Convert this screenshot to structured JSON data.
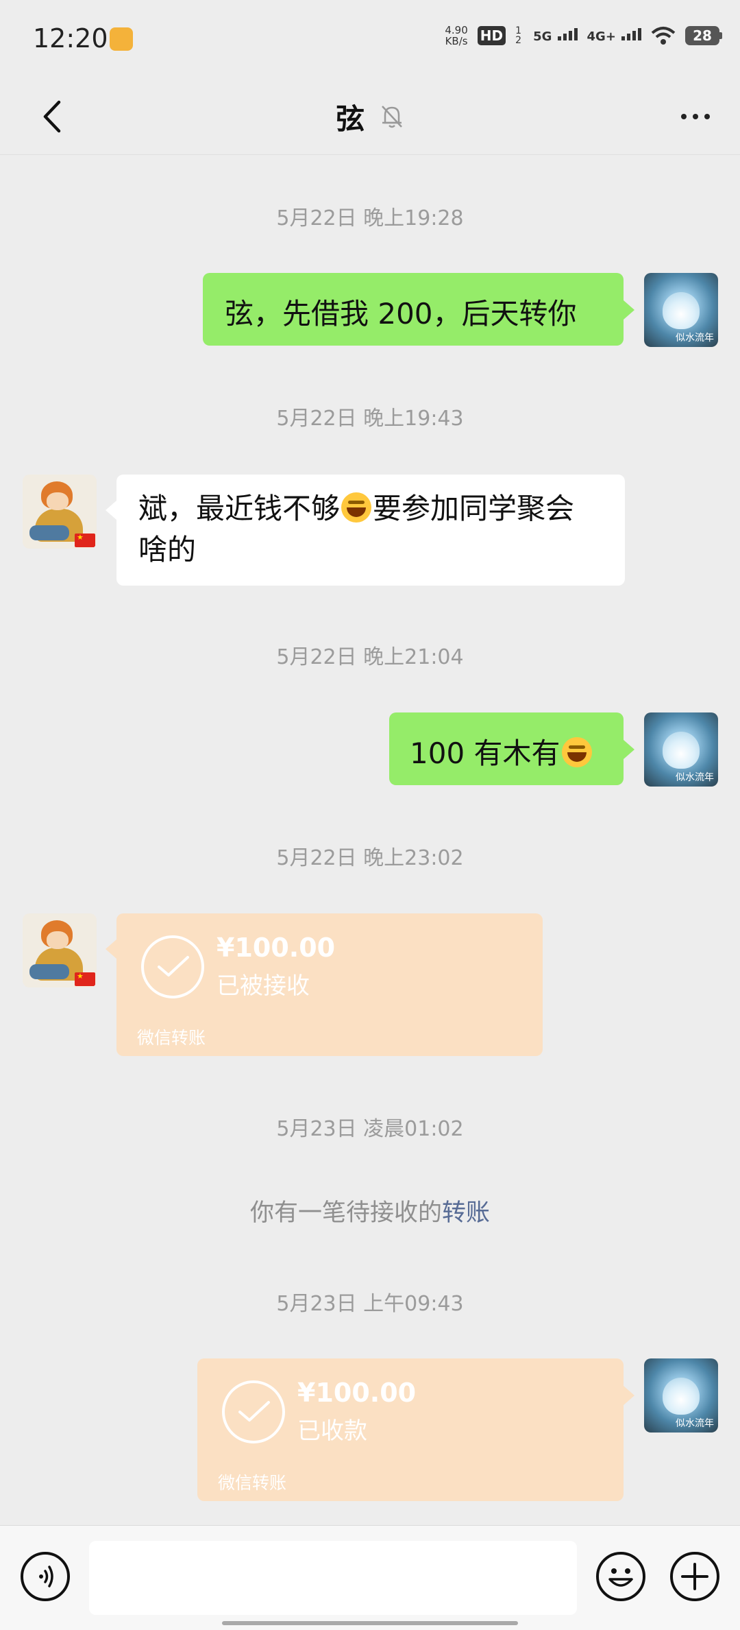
{
  "status_bar": {
    "time": "12:20",
    "net_speed_value": "4.90",
    "net_speed_unit": "KB/s",
    "hd_label": "HD",
    "hd_sub": "1 2",
    "sig1": "5G",
    "sig2": "4G+",
    "battery": "28"
  },
  "header": {
    "title": "弦",
    "mute_icon": "bell-off-icon",
    "back_icon": "chevron-left-icon",
    "more_icon": "more-dots-icon"
  },
  "messages": [
    {
      "type": "timestamp",
      "text": "5月22日 晚上19:28"
    },
    {
      "type": "text",
      "side": "right",
      "text": "弦，先借我 200，后天转你"
    },
    {
      "type": "timestamp",
      "text": "5月22日 晚上19:43"
    },
    {
      "type": "text",
      "side": "left",
      "text_line1": "斌，最近钱不够",
      "text_line1b": "要参加同学聚会",
      "text_line2": "啥的"
    },
    {
      "type": "timestamp",
      "text": "5月22日 晚上21:04"
    },
    {
      "type": "text",
      "side": "right",
      "text": "100 有木有"
    },
    {
      "type": "timestamp",
      "text": "5月22日 晚上23:02"
    },
    {
      "type": "transfer",
      "side": "left",
      "amount": "¥100.00",
      "status": "已被接收",
      "footer": "微信转账"
    },
    {
      "type": "timestamp",
      "text": "5月23日 凌晨01:02"
    },
    {
      "type": "system",
      "text": "你有一笔待接收的",
      "link": "转账"
    },
    {
      "type": "timestamp",
      "text": "5月23日 上午09:43"
    },
    {
      "type": "transfer",
      "side": "right",
      "amount": "¥100.00",
      "status": "已收款",
      "footer": "微信转账"
    }
  ],
  "avatars": {
    "self_caption": "似水流年"
  },
  "input_bar": {
    "placeholder": "",
    "voice_icon": "voice-icon",
    "emoji_icon": "emoji-icon",
    "plus_icon": "plus-icon"
  },
  "colors": {
    "background": "#EDEDED",
    "sent_bubble": "#95EC69",
    "received_bubble": "#FFFFFF",
    "transfer_bubble": "#FBE0C3",
    "link": "#576B95"
  }
}
